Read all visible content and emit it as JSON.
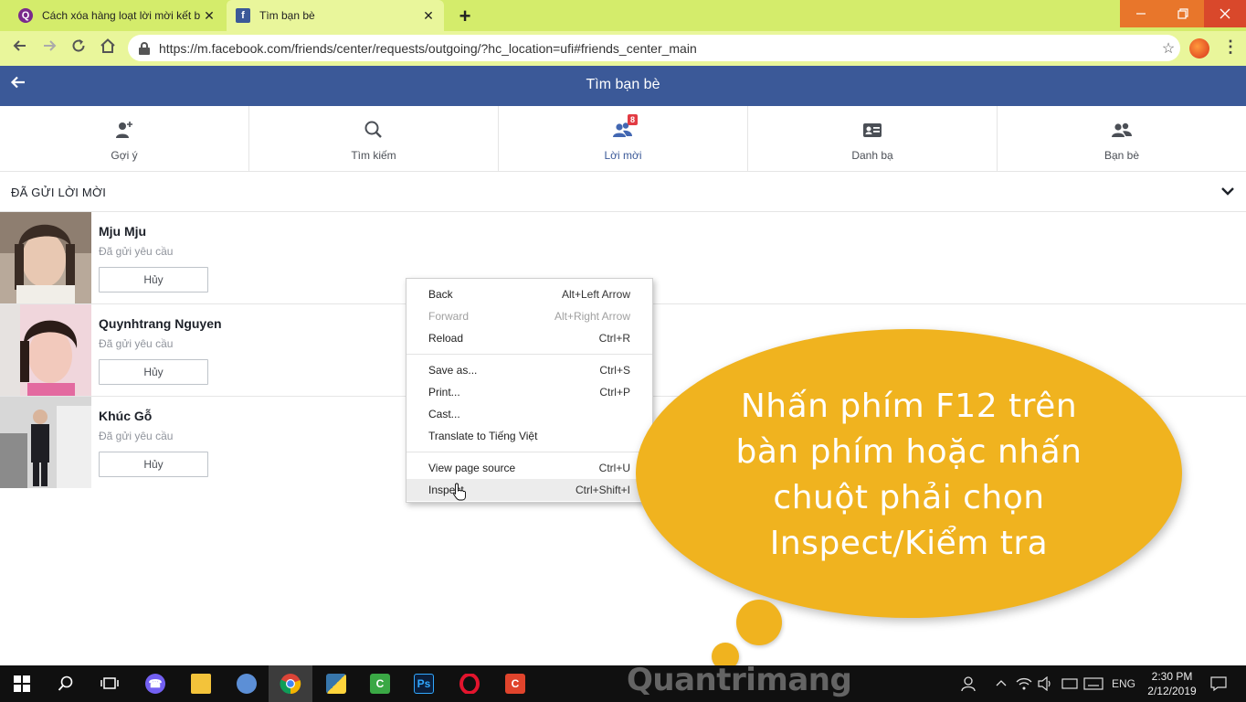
{
  "browser": {
    "tabs": [
      {
        "title": "Cách xóa hàng loạt lời mời kết b",
        "close": "✕"
      },
      {
        "title": "Tìm bạn bè",
        "close": "✕"
      }
    ],
    "new_tab": "+",
    "url": "https://m.facebook.com/friends/center/requests/outgoing/?hc_location=ufi#friends_center_main"
  },
  "header": {
    "title": "Tìm bạn bè"
  },
  "nav": [
    {
      "label": "Gợi ý"
    },
    {
      "label": "Tìm kiếm"
    },
    {
      "label": "Lời mời",
      "badge": "8"
    },
    {
      "label": "Danh bạ"
    },
    {
      "label": "Bạn bè"
    }
  ],
  "section": {
    "title": "ĐÃ GỬI LỜI MỜI"
  },
  "requests": [
    {
      "name": "Mju Mju",
      "status": "Đã gửi yêu cầu",
      "button": "Hủy"
    },
    {
      "name": "Quynhtrang Nguyen",
      "status": "Đã gửi yêu cầu",
      "button": "Hủy"
    },
    {
      "name": "Khúc Gỗ",
      "status": "Đã gửi yêu cầu",
      "button": "Hủy"
    }
  ],
  "context_menu": [
    {
      "label": "Back",
      "shortcut": "Alt+Left Arrow"
    },
    {
      "label": "Forward",
      "shortcut": "Alt+Right Arrow"
    },
    {
      "label": "Reload",
      "shortcut": "Ctrl+R"
    },
    {
      "label": "Save as...",
      "shortcut": "Ctrl+S"
    },
    {
      "label": "Print...",
      "shortcut": "Ctrl+P"
    },
    {
      "label": "Cast...",
      "shortcut": ""
    },
    {
      "label": "Translate to Tiếng Việt",
      "shortcut": ""
    },
    {
      "label": "View page source",
      "shortcut": "Ctrl+U"
    },
    {
      "label": "Inspect",
      "shortcut": "Ctrl+Shift+I"
    }
  ],
  "callout": {
    "lines": [
      "Nhấn phím F12 trên",
      "bàn phím hoặc nhấn",
      "chuột phải chọn",
      "Inspect/Kiểm tra"
    ]
  },
  "taskbar": {
    "watermark": "Quantrimang",
    "language": "ENG",
    "time": "2:30 PM",
    "date": "2/12/2019"
  },
  "colors": {
    "fb_blue": "#3b5998",
    "chrome_tab_strip": "#d4ec6b",
    "callout_yellow": "#f0b31f"
  }
}
